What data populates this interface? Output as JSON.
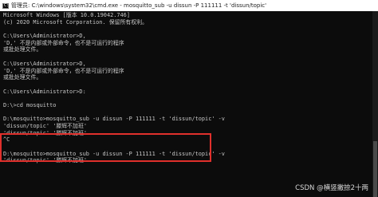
{
  "window": {
    "title": "管理员: C:\\windows\\system32\\cmd.exe - mosquitto_sub  -u dissun -P 111111 -t 'dissun/topic'",
    "icon_text": "C:\\",
    "colors": {
      "background": "#0c0c0c",
      "text": "#c7c7c7",
      "highlight": "#e0302c"
    }
  },
  "console": {
    "lines": [
      "Microsoft Windows [版本 10.0.19042.746]",
      "(c) 2020 Microsoft Corporation. 保留所有权利。",
      "",
      "C:\\Users\\Administrator>D,",
      "'D,' 不是内部或外部命令，也不是可运行的程序",
      "或批处理文件。",
      "",
      "C:\\Users\\Administrator>D,",
      "'D,' 不是内部或外部命令，也不是可运行的程序",
      "或批处理文件。",
      "",
      "C:\\Users\\Administrator>D:",
      "",
      "D:\\>cd mosquitto",
      "",
      "D:\\mosquitto>mosquitto_sub -u dissun -P 111111 -t 'dissun/topic' -v",
      "'dissun/topic' '滕辉不加班'",
      "'dissun/topic' '滕辉不加班'",
      "^C",
      "",
      "D:\\mosquitto>mosquitto_sub -u dissun -P 111111 -t 'dissun/topic' -v",
      "'dissun/topic' '滕辉不加班'",
      "",
      ""
    ]
  },
  "watermark": "CSDN @横竖撇捺2十两"
}
